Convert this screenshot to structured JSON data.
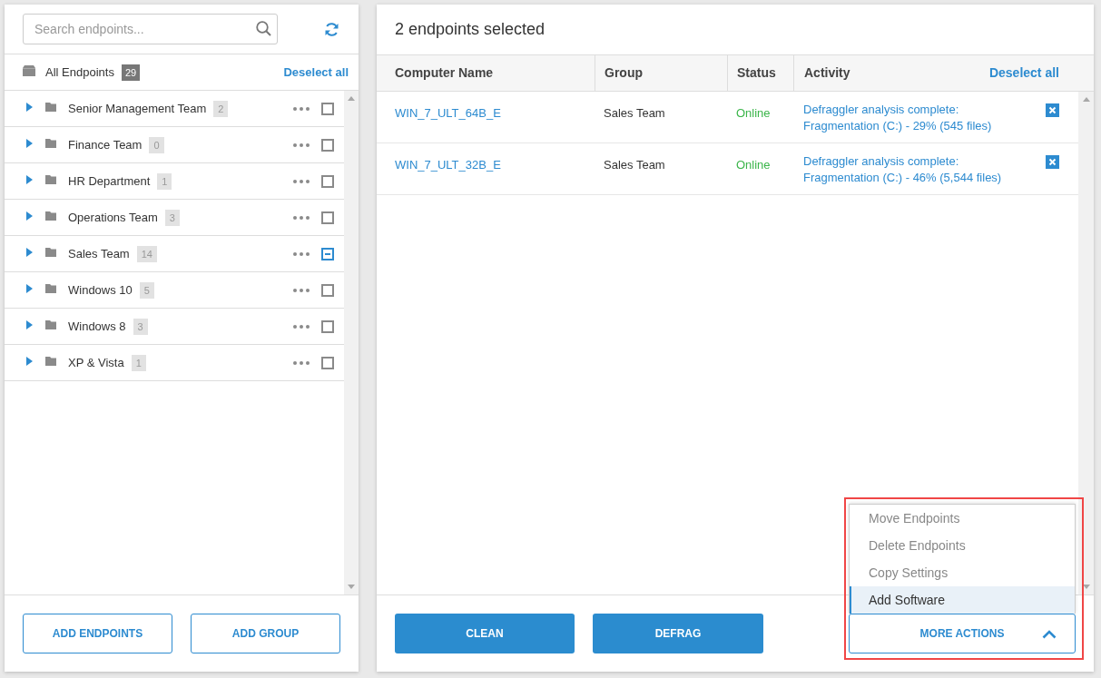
{
  "sidebar": {
    "search": {
      "placeholder": "Search endpoints..."
    },
    "all_endpoints": {
      "label": "All Endpoints",
      "count": "29",
      "action": "Deselect all"
    },
    "groups": [
      {
        "name": "Senior Management Team",
        "count": "2",
        "indeterminate": false
      },
      {
        "name": "Finance Team",
        "count": "0",
        "indeterminate": false
      },
      {
        "name": "HR Department",
        "count": "1",
        "indeterminate": false
      },
      {
        "name": "Operations Team",
        "count": "3",
        "indeterminate": false
      },
      {
        "name": "Sales Team",
        "count": "14",
        "indeterminate": true
      },
      {
        "name": "Windows 10",
        "count": "5",
        "indeterminate": false
      },
      {
        "name": "Windows 8",
        "count": "3",
        "indeterminate": false
      },
      {
        "name": "XP & Vista",
        "count": "1",
        "indeterminate": false
      }
    ],
    "buttons": [
      "ADD ENDPOINTS",
      "ADD GROUP"
    ]
  },
  "main": {
    "title": "2 endpoints selected",
    "table": {
      "columns": [
        "Computer Name",
        "Group",
        "Status",
        "Activity"
      ],
      "action": "Deselect all",
      "rows": [
        {
          "computer_name": "WIN_7_ULT_64B_E",
          "group": "Sales Team",
          "status": "Online",
          "activity": "Defraggler analysis complete:\nFragmentation (C:) - 29% (545 files)"
        },
        {
          "computer_name": "WIN_7_ULT_32B_E",
          "group": "Sales Team",
          "status": "Online",
          "activity": "Defraggler analysis complete:\nFragmentation (C:) - 46% (5,544 files)"
        }
      ]
    },
    "buttons": [
      "CLEAN",
      "DEFRAG"
    ],
    "more_actions": {
      "label": "MORE ACTIONS",
      "expanded": true,
      "highlighted": true,
      "menu": [
        {
          "label": "Move Endpoints",
          "selected": false
        },
        {
          "label": "Delete Endpoints",
          "selected": false
        },
        {
          "label": "Copy Settings",
          "selected": false
        },
        {
          "label": "Add Software",
          "selected": true
        }
      ]
    }
  }
}
